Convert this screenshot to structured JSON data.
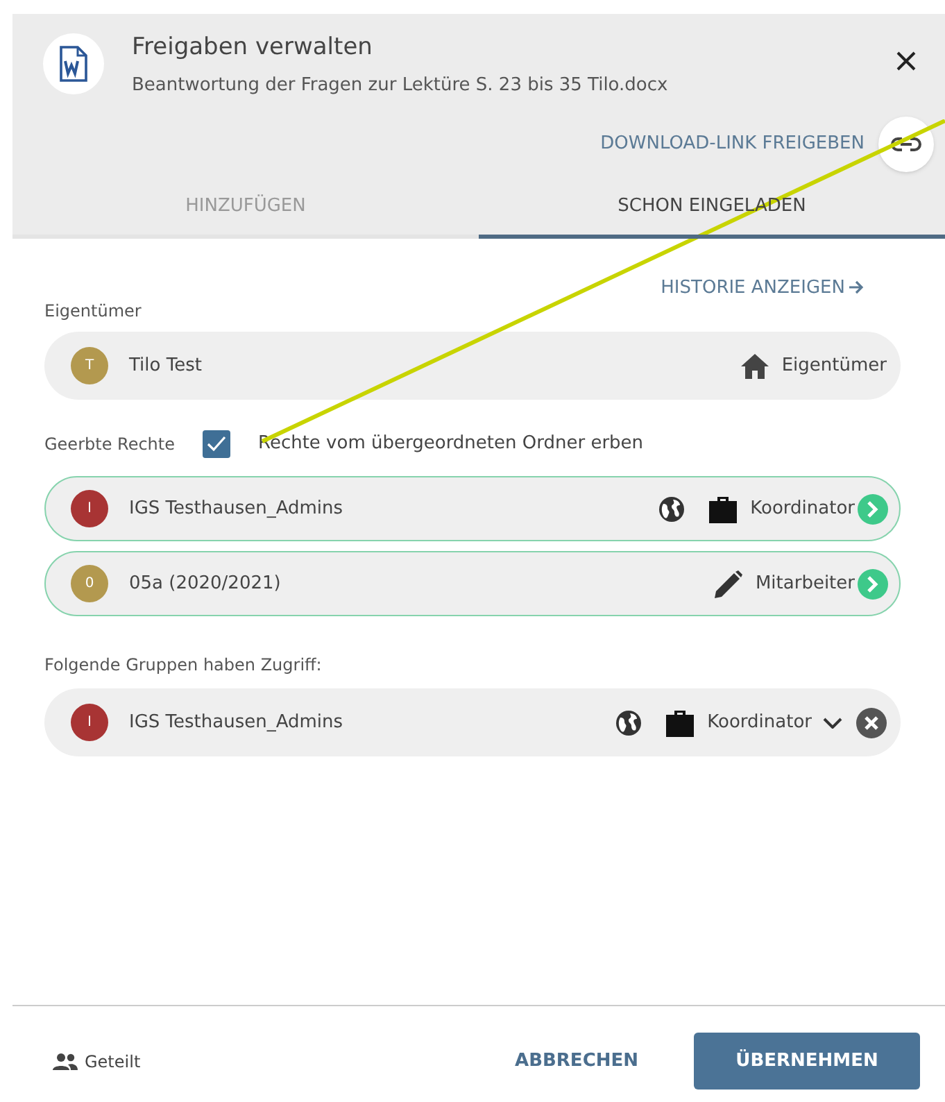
{
  "dialog": {
    "title": "Freigaben verwalten",
    "subtitle": "Beantwortung der Fragen zur Lektüre S. 23 bis 35 Tilo.docx",
    "download_link": "DOWNLOAD-LINK FREIGEBEN"
  },
  "tabs": [
    {
      "label": "HINZUFÜGEN",
      "selected": false
    },
    {
      "label": "SCHON EINGELADEN",
      "selected": true
    }
  ],
  "history_link": "HISTORIE ANZEIGEN",
  "owner": {
    "label": "Eigentümer",
    "entry": {
      "initial": "T",
      "color": "#b3994f",
      "name": "Tilo Test",
      "kind": "owner",
      "role": "Eigentümer"
    }
  },
  "inherited": {
    "label": "Geerbte Rechte",
    "checked": true,
    "checkbox_label": "Rechte vom übergeordneten Ordner erben",
    "entries": [
      {
        "initial": "I",
        "color": "#a83434",
        "name": "IGS Testhausen_Admins",
        "kind": "coordinator",
        "role": "Koordinator"
      },
      {
        "initial": "0",
        "color": "#b3994f",
        "name": "05a (2020/2021)",
        "kind": "member",
        "role": "Mitarbeiter"
      }
    ]
  },
  "groups": {
    "label": "Folgende Gruppen haben Zugriff:",
    "entries": [
      {
        "initial": "I",
        "color": "#a83434",
        "name": "IGS Testhausen_Admins",
        "kind": "coordinator",
        "role": "Koordinator"
      }
    ]
  },
  "footer": {
    "shared": "Geteilt",
    "cancel": "ABBRECHEN",
    "apply": "ÜBERNEHMEN"
  }
}
